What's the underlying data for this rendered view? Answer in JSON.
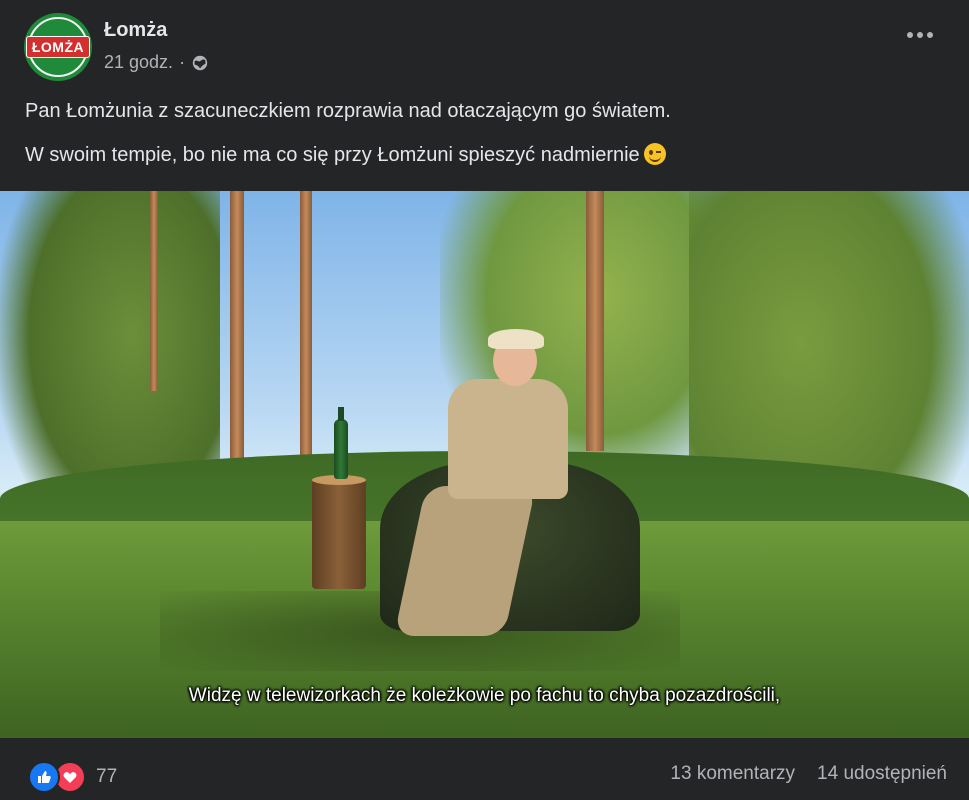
{
  "post": {
    "page_name": "Łomża",
    "logo_text": "ŁOMŻA",
    "time": "21 godz.",
    "separator": "·",
    "privacy_icon": "globe-icon",
    "more_icon": "more-options-icon",
    "text_lines": [
      "Pan Łomżunia z szacuneczkiem rozprawia nad otaczającym go światem.",
      "W swoim tempie, bo nie ma co się przy Łomżuni spieszyć nadmiernie"
    ],
    "emoji": "winking-face-icon"
  },
  "media": {
    "subtitle": "Widzę w telewizorkach że koleżkowie po fachu to  chyba pozazdrościli,"
  },
  "footer": {
    "reaction_icons": [
      "like-icon",
      "love-icon"
    ],
    "reaction_count": "77",
    "comments": "13 komentarzy",
    "shares": "14 udostępnień"
  },
  "colors": {
    "background": "#242526",
    "text": "#e4e6eb",
    "secondary_text": "#b0b3b8",
    "like": "#1877f2",
    "love": "#f33e58",
    "brand_green": "#1f8a3a",
    "brand_red": "#d32f2f"
  }
}
